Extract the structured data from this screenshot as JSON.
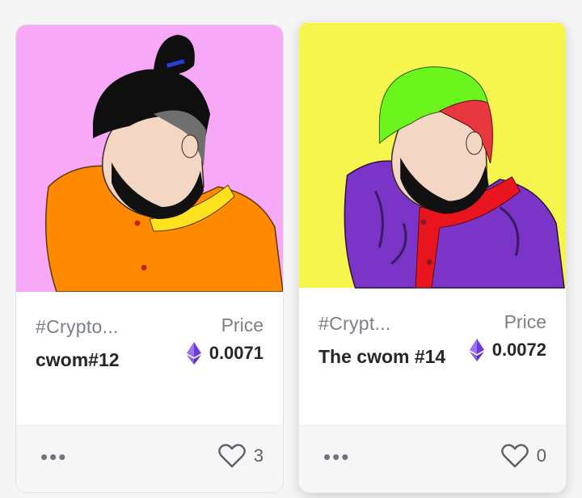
{
  "cards": [
    {
      "collection": "#Crypto...",
      "name": "cwom#12",
      "price_label": "Price",
      "price": "0.0071",
      "more": "•••",
      "likes": "3",
      "bg_color": "#f7a8f7",
      "icons": [
        "ethereum-icon",
        "heart-icon",
        "more-icon"
      ]
    },
    {
      "collection": "#Crypt...",
      "name": "The cwom #14",
      "price_label": "Price",
      "price": "0.0072",
      "more": "•••",
      "likes": "0",
      "bg_color": "#f5f54d",
      "icons": [
        "ethereum-icon",
        "heart-icon",
        "more-icon"
      ]
    }
  ]
}
